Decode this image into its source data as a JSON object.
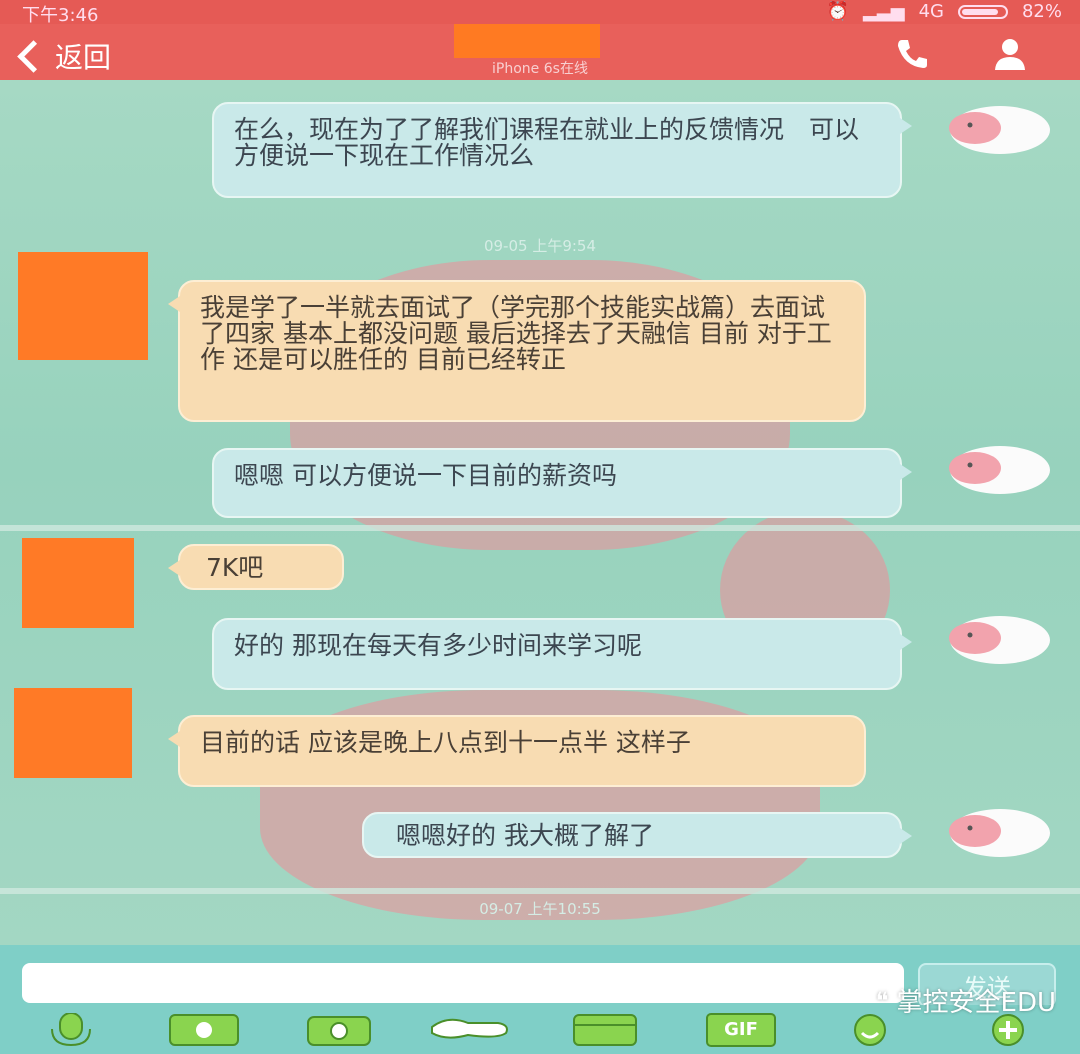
{
  "status_bar": {
    "time": "下午3:46",
    "network": "4G",
    "battery": "82%"
  },
  "nav": {
    "back_label": "返回",
    "subtitle": "iPhone 6s在线"
  },
  "messages": [
    {
      "sender": "me",
      "text": "在么，现在为了了解我们课程在就业上的反馈情况　可以方便说一下现在工作情况么"
    },
    {
      "sender": "them",
      "text": "我是学了一半就去面试了（学完那个技能实战篇）去面试了四家 基本上都没问题 最后选择去了天融信 目前 对于工作 还是可以胜任的 目前已经转正"
    },
    {
      "sender": "me",
      "text": "嗯嗯 可以方便说一下目前的薪资吗"
    },
    {
      "sender": "them",
      "text": "7K吧"
    },
    {
      "sender": "me",
      "text": "好的 那现在每天有多少时间来学习呢"
    },
    {
      "sender": "them",
      "text": "目前的话 应该是晚上八点到十一点半 这样子"
    },
    {
      "sender": "me",
      "text": "嗯嗯好的 我大概了解了"
    }
  ],
  "timestamps": [
    "09-05 上午9:54",
    "09-07 上午10:55"
  ],
  "input": {
    "value": "",
    "send_label": "发送"
  },
  "toolbar": {
    "icons": [
      "mic-icon",
      "image-icon",
      "camera-icon",
      "shake-icon",
      "file-icon",
      "gif-icon",
      "emoji-icon",
      "plus-icon"
    ],
    "gif_label": "GIF"
  },
  "watermark": "掌控安全EDU",
  "colors": {
    "header": "#e8605b",
    "chat_bg": "#9fd6c2",
    "my_bubble": "#c9e9e9",
    "their_bubble": "#f8dcb2",
    "redaction": "#ff7a22",
    "toolbar": "#7fcfc7"
  }
}
